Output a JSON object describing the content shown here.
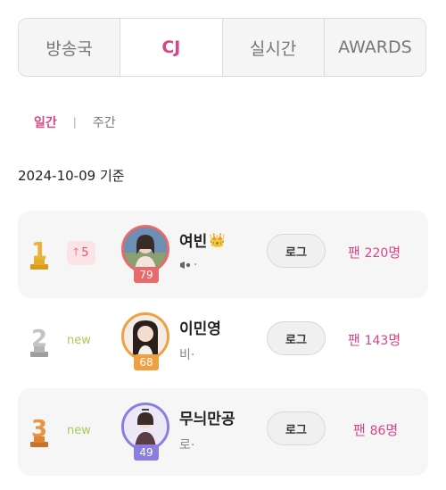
{
  "tabs": [
    {
      "label": "방송국",
      "active": false
    },
    {
      "label": "CJ",
      "active": true
    },
    {
      "label": "실시간",
      "active": false
    },
    {
      "label": "AWARDS",
      "active": false
    }
  ],
  "subtabs": {
    "daily": "일간",
    "separator": "|",
    "weekly": "주간"
  },
  "date_label": "2024-10-09 기준",
  "rankings": [
    {
      "rank": "1",
      "trend": "5",
      "name": "여빈",
      "crown": "👑",
      "sub": "·",
      "level": "79",
      "log_label": "로그",
      "fans_prefix": "팬",
      "fans_count": "220",
      "fans_suffix": "명"
    },
    {
      "rank": "2",
      "trend": "new",
      "name": "이민영",
      "sub": "비·",
      "level": "68",
      "log_label": "로그",
      "fans_prefix": "팬",
      "fans_count": "143",
      "fans_suffix": "명"
    },
    {
      "rank": "3",
      "trend": "new",
      "name": "무늬만공",
      "sub": "로·",
      "level": "49",
      "log_label": "로그",
      "fans_prefix": "팬",
      "fans_count": "86",
      "fans_suffix": "명"
    }
  ],
  "colors": {
    "accent": "#d9458a",
    "gold": "#e0a72c",
    "silver": "#b0b0b0",
    "bronze": "#e08a3a",
    "level1": "#e86a6a",
    "level2": "#f0a040",
    "level3": "#8a7ee0"
  }
}
